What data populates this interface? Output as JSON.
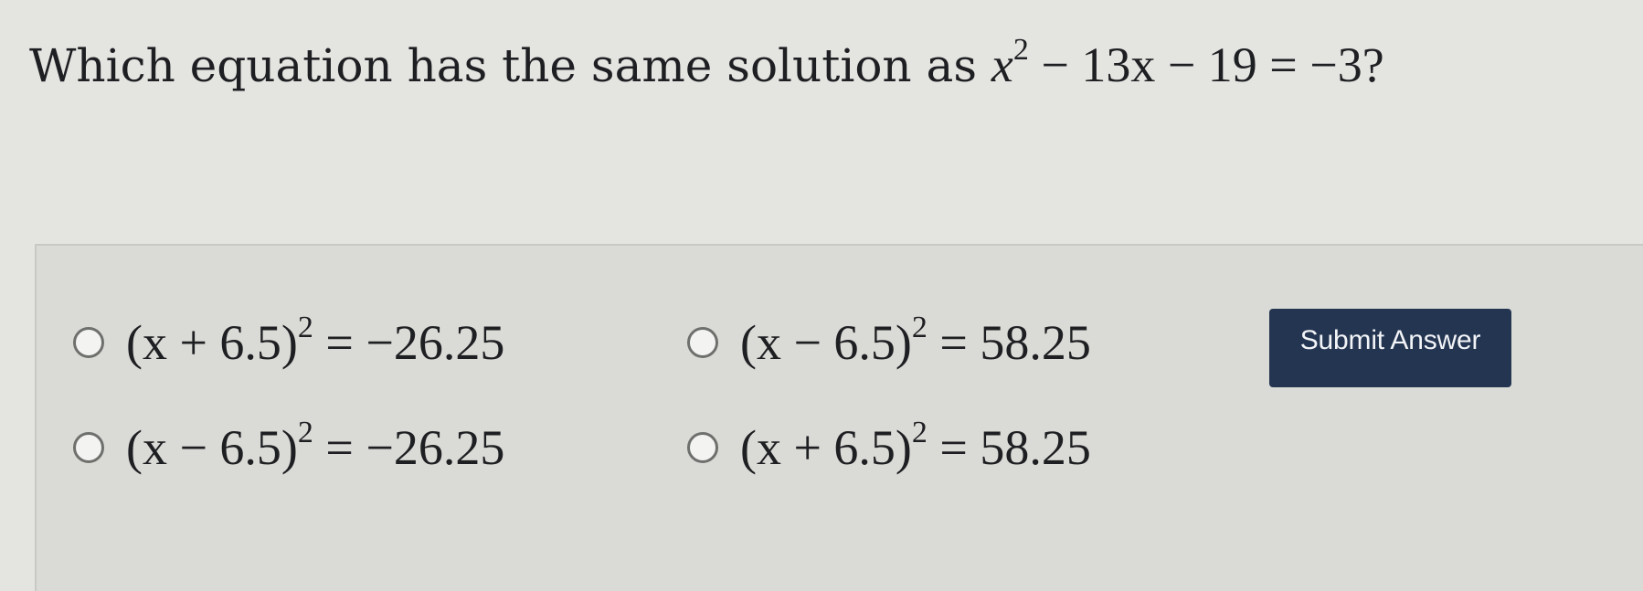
{
  "question": {
    "prefix": "Which equation has the same solution as",
    "equation_var": "x",
    "equation_exponent": "2",
    "equation_rest": "− 13x − 19 = −3",
    "suffix": "?"
  },
  "choices": [
    {
      "id": "a",
      "before": "(x + 6.5)",
      "exponent": "2",
      "after": "= −26.25"
    },
    {
      "id": "b",
      "before": "(x − 6.5)",
      "exponent": "2",
      "after": "= 58.25"
    },
    {
      "id": "c",
      "before": "(x − 6.5)",
      "exponent": "2",
      "after": "= −26.25"
    },
    {
      "id": "d",
      "before": "(x + 6.5)",
      "exponent": "2",
      "after": "= 58.25"
    }
  ],
  "submit_button": {
    "label": "Submit Answer"
  },
  "colors": {
    "page_background": "#e4e5e1",
    "panel_background": "#dadbd6",
    "button_background": "#243551",
    "button_text": "#f2f4f7"
  }
}
